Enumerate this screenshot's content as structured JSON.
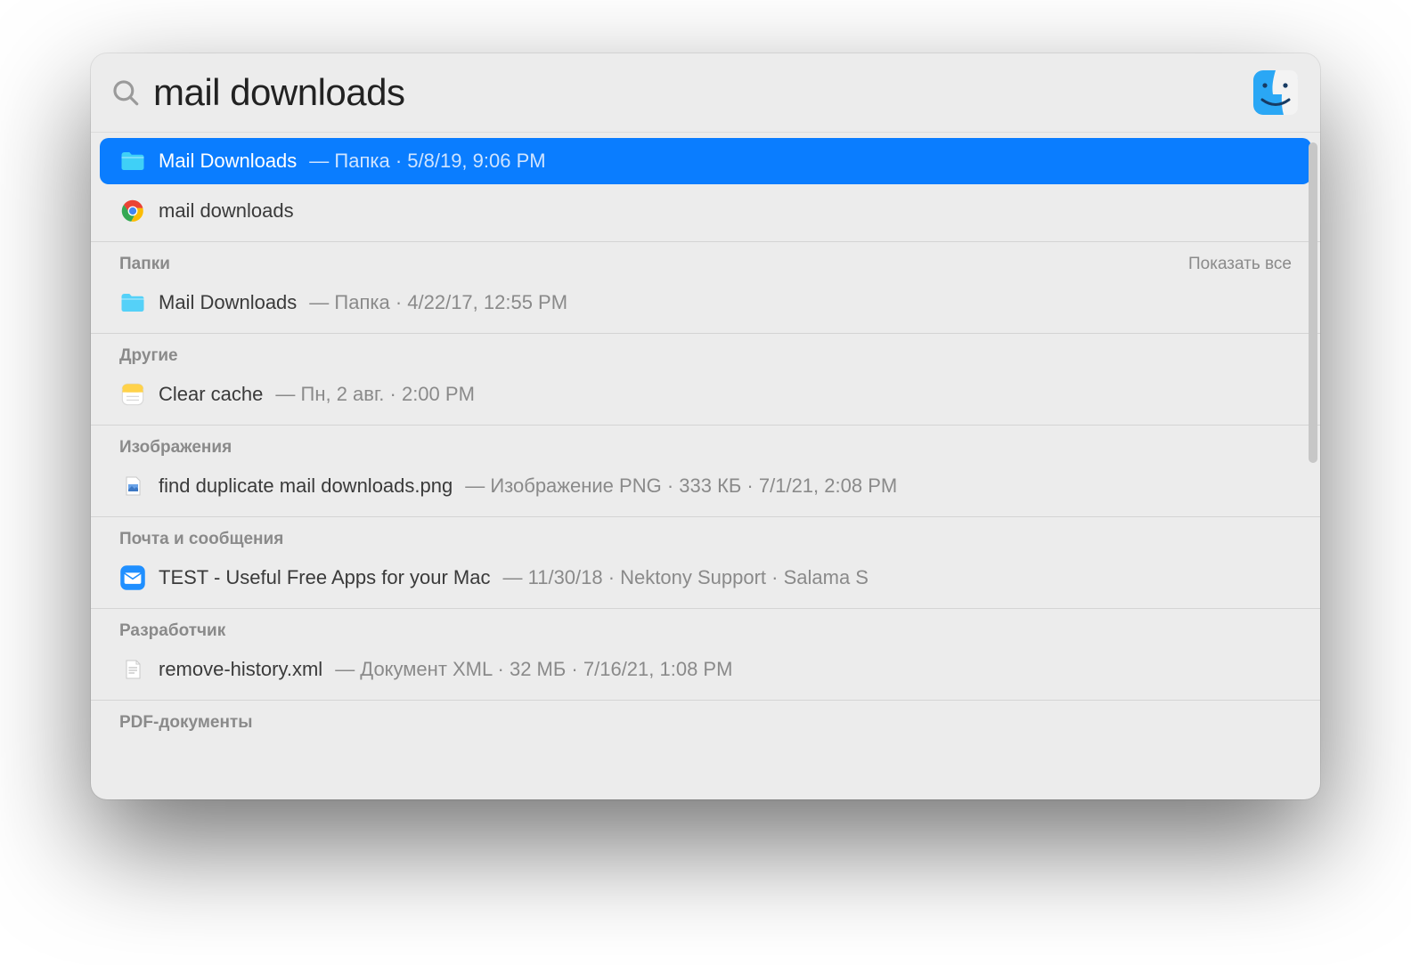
{
  "search": {
    "query": "mail downloads"
  },
  "top_hit": {
    "name": "Mail Downloads",
    "meta": "— Папка · 5/8/19, 9:06 PM"
  },
  "chrome_suggestion": {
    "name": "mail downloads"
  },
  "sections": [
    {
      "title": "Папки",
      "show_all": "Показать все",
      "items": [
        {
          "icon": "folder",
          "name": "Mail Downloads",
          "meta": "— Папка · 4/22/17, 12:55 PM"
        }
      ]
    },
    {
      "title": "Другие",
      "items": [
        {
          "icon": "note",
          "name": "Clear cache",
          "meta": "— Пн, 2 авг. · 2:00 PM"
        }
      ]
    },
    {
      "title": "Изображения",
      "items": [
        {
          "icon": "image",
          "name": "find duplicate mail downloads.png",
          "meta": "— Изображение PNG · 333 КБ · 7/1/21, 2:08 PM"
        }
      ]
    },
    {
      "title": "Почта и сообщения",
      "items": [
        {
          "icon": "mail",
          "name": "TEST - Useful Free Apps for your Mac",
          "meta": "— 11/30/18 · Nektony Support · Salama S"
        }
      ]
    },
    {
      "title": "Разработчик",
      "items": [
        {
          "icon": "xml",
          "name": "remove-history.xml",
          "meta": "— Документ XML · 32 МБ · 7/16/21, 1:08 PM"
        }
      ]
    },
    {
      "title": "PDF-документы",
      "items": []
    }
  ]
}
